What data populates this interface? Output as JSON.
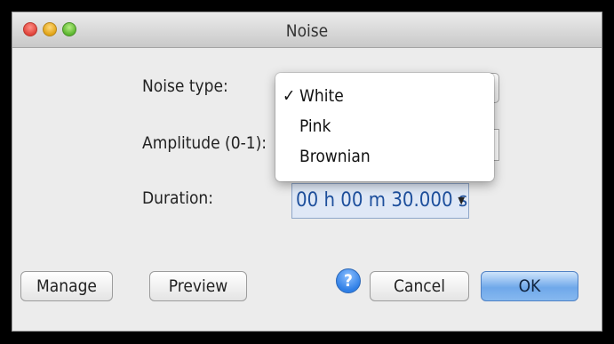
{
  "window": {
    "title": "Noise"
  },
  "form": {
    "noise_type_label": "Noise type:",
    "amplitude_label": "Amplitude (0-1):",
    "duration_label": "Duration:",
    "duration_value": "00 h 00 m 30.000 s"
  },
  "dropdown": {
    "checkmark": "✓",
    "options": [
      "White",
      "Pink",
      "Brownian"
    ],
    "selected": "White"
  },
  "buttons": {
    "manage": "Manage",
    "preview": "Preview",
    "help": "?",
    "cancel": "Cancel",
    "ok": "OK"
  },
  "colors": {
    "ok_accent": "#6fa8ea",
    "duration_text": "#1d4f9c"
  }
}
